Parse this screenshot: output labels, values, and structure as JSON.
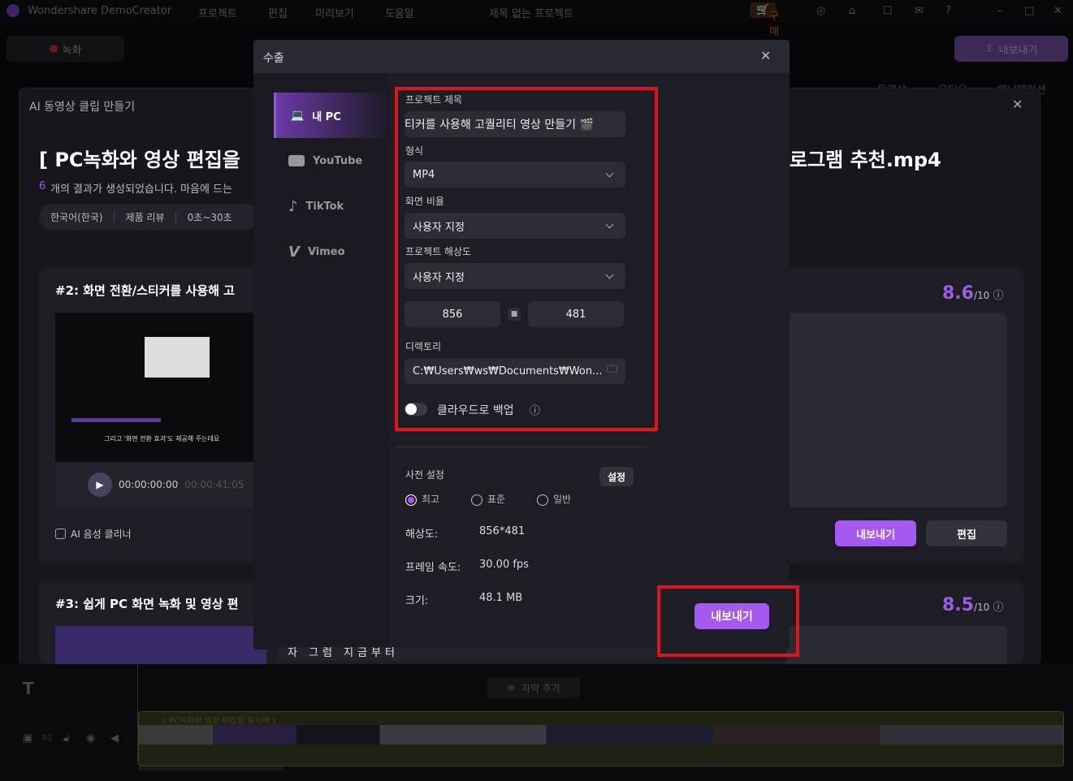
{
  "app": {
    "name": "Wondershare DemoCreator",
    "menu": [
      "프로젝트",
      "편집",
      "미리보기",
      "도움말"
    ],
    "project_title": "제목 없는 프로젝트",
    "buy": "구매",
    "record": "녹화",
    "export": "내보내기",
    "tabs_right": [
      "동영상",
      "오디오",
      "애니메이션"
    ]
  },
  "ai_dialog": {
    "title": "AI 동영상 클립 만들기",
    "heading_left": "[ PC녹화와 영상 편집을",
    "heading_right": "로그램 추천.mp4",
    "count": "6",
    "result_text": "개의 결과가 생성되었습니다. 마음에 드는",
    "filters": [
      "한국어(한국)",
      "제품 리뷰",
      "0초~30초"
    ],
    "clips": [
      {
        "title": "#2:  화면 전환/스티커를 사용해 고",
        "score": "8.6",
        "score_max": "/10",
        "time_current": "00:00:00:00",
        "time_total": "00:00:41:05",
        "subtitle": "그리고 '화면 전환 효과'도 제공해 주는데요",
        "checkbox_label": "AI 음성 클리너",
        "export": "내보내기",
        "edit": "편집"
      },
      {
        "title": "#3:  쉽게 PC 화면 녹화 및 영상 편",
        "score": "8.5",
        "score_max": "/10"
      }
    ]
  },
  "export_dialog": {
    "title": "수출",
    "nav": [
      {
        "label": "내 PC",
        "icon": "laptop-icon"
      },
      {
        "label": "YouTube",
        "icon": "youtube-icon"
      },
      {
        "label": "TikTok",
        "icon": "tiktok-icon"
      },
      {
        "label": "Vimeo",
        "icon": "vimeo-icon"
      }
    ],
    "project_title_label": "프로젝트 제목",
    "project_title_value": "티커를 사용해 고퀄리티 영상 만들기 🎬",
    "format_label": "형식",
    "format_value": "MP4",
    "ratio_label": "화면 비율",
    "ratio_value": "사용자 지정",
    "resolution_label": "프로젝트 해상도",
    "resolution_value": "사용자 지정",
    "width": "856",
    "height": "481",
    "directory_label": "디렉토리",
    "directory_value": "C:₩Users₩ws₩Documents₩Won...",
    "cloud_backup_label": "클라우드로 백업",
    "cloud_backup_on": false,
    "preset_label": "사전 설정",
    "settings_button": "설정",
    "presets": [
      "최고",
      "표준",
      "일반"
    ],
    "preset_selected": "최고",
    "info": [
      {
        "k": "해상도:",
        "v": "856*481"
      },
      {
        "k": "프레임 속도:",
        "v": "30.00 fps"
      },
      {
        "k": "크기:",
        "v": "48.1 MB"
      }
    ],
    "export_button": "내보내기",
    "bottom_caption": "자 그럼 지금부터"
  },
  "timeline": {
    "add_subtitle": "자막 추가",
    "clip_title": "[ PC녹화와 영상 편집을 동시에 ] ...",
    "track": "01"
  },
  "colors": {
    "accent": "#a659f0",
    "highlight": "#e0141e"
  }
}
